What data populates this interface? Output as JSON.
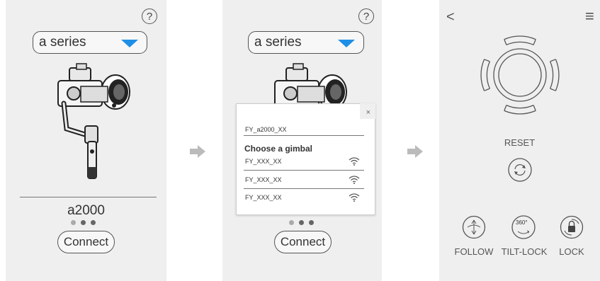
{
  "screen1": {
    "help_icon": "?",
    "series_select": "a series",
    "model_name": "a2000",
    "pager": [
      true,
      true,
      true
    ],
    "connect_button": "Connect"
  },
  "screen2": {
    "help_icon": "?",
    "series_select": "a series",
    "popup": {
      "close": "×",
      "connected_device": "FY_a2000_XX",
      "heading": "Choose a gimbal",
      "devices": [
        "FY_XXX_XX",
        "FY_XXX_XX",
        "FY_XXX_XX"
      ]
    },
    "connect_button": "Connect"
  },
  "screen3": {
    "back_icon": "<",
    "menu_icon": "≡",
    "reset_label": "RESET",
    "modes": [
      {
        "label": "FOLLOW",
        "icon": "follow-icon"
      },
      {
        "label": "TILT-LOCK",
        "icon": "tilt-lock-icon",
        "badge": "360°"
      },
      {
        "label": "LOCK",
        "icon": "lock-icon"
      }
    ]
  }
}
